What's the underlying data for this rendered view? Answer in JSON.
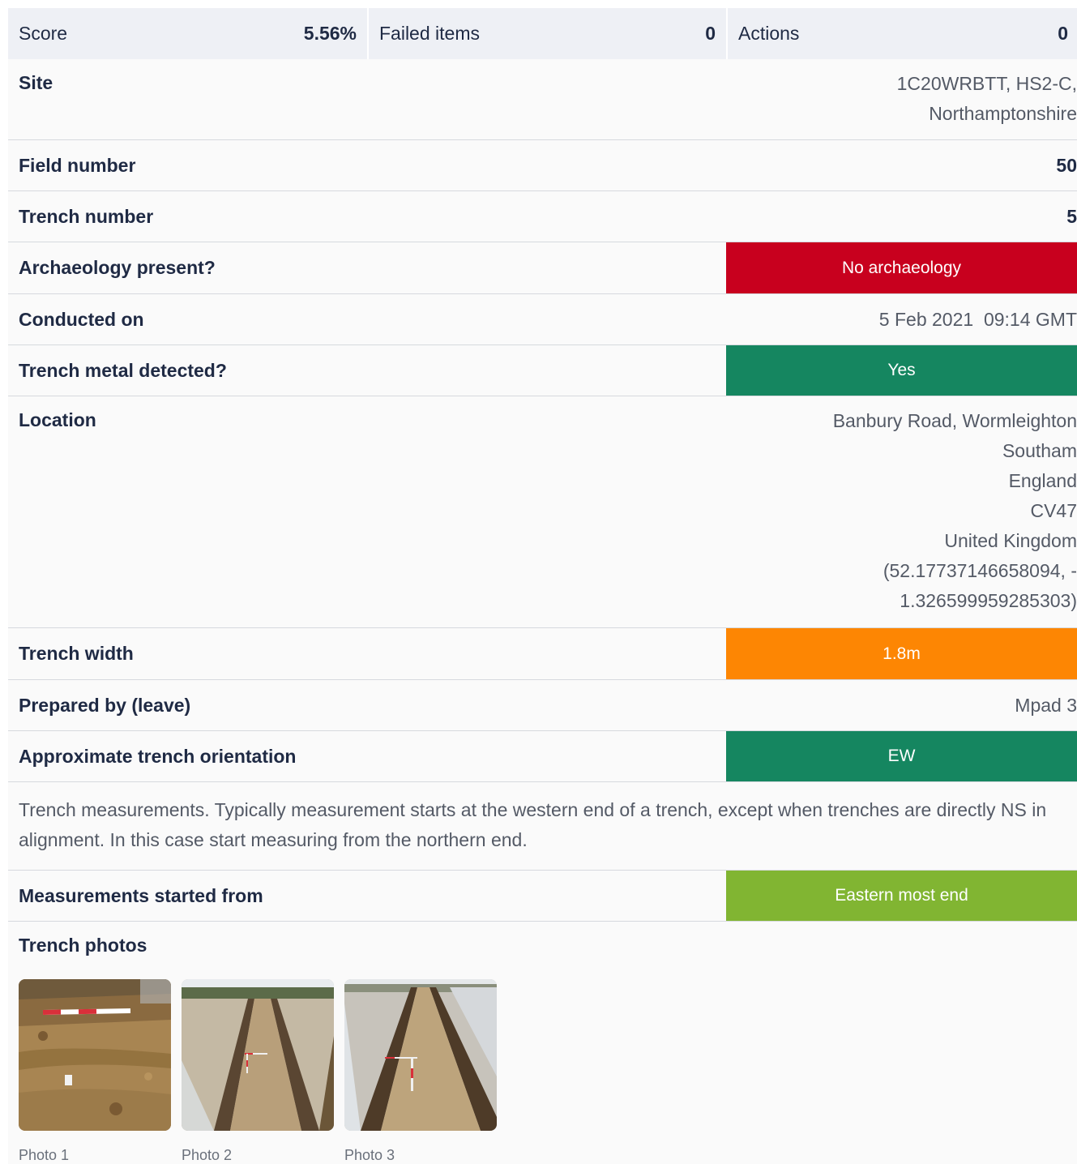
{
  "summary": {
    "score_label": "Score",
    "score_value": "5.56%",
    "failed_label": "Failed items",
    "failed_value": "0",
    "actions_label": "Actions",
    "actions_value": "0"
  },
  "rows": {
    "site": {
      "label": "Site",
      "lines": [
        "1C20WRBTT, HS2-C,",
        "Northamptonshire"
      ]
    },
    "field_number": {
      "label": "Field number",
      "value": "50"
    },
    "trench_number": {
      "label": "Trench number",
      "value": "5"
    },
    "archaeology": {
      "label": "Archaeology present?",
      "value": "No archaeology"
    },
    "conducted": {
      "label": "Conducted on",
      "value": "5 Feb 2021  09:14 GMT"
    },
    "metal": {
      "label": "Trench metal detected?",
      "value": "Yes"
    },
    "location": {
      "label": "Location",
      "lines": [
        "Banbury Road, Wormleighton",
        "Southam",
        "England",
        "CV47",
        "United Kingdom",
        "(52.17737146658094, -",
        "1.326599959285303)"
      ]
    },
    "width": {
      "label": "Trench width",
      "value": "1.8m"
    },
    "prepared": {
      "label": "Prepared by (leave)",
      "value": "Mpad 3"
    },
    "orientation": {
      "label": "Approximate trench orientation",
      "value": "EW"
    },
    "measurements_note": "Trench measurements. Typically measurement starts at the western end of a trench, except when trenches are directly NS in alignment. In this case start measuring from the northern end.",
    "started_from": {
      "label": "Measurements started from",
      "value": "Eastern most end"
    }
  },
  "photos": {
    "title": "Trench photos",
    "items": [
      {
        "caption": "Photo 1"
      },
      {
        "caption": "Photo 2"
      },
      {
        "caption": "Photo 3"
      }
    ]
  },
  "colors": {
    "red": "#c8001e",
    "green": "#158660",
    "orange": "#fd8603",
    "lime": "#81b532"
  }
}
